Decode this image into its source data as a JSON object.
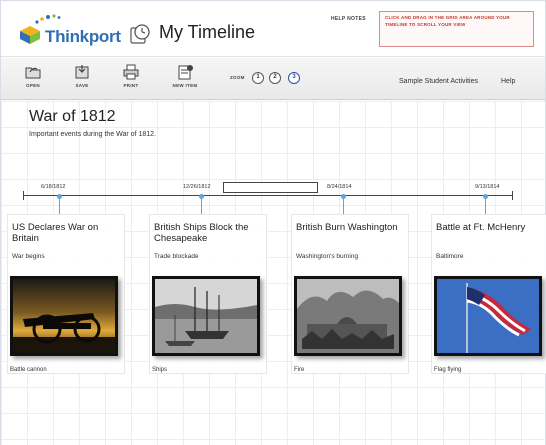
{
  "header": {
    "brand": "Thinkport",
    "app_title": "My Timeline",
    "help_notes_label": "HELP NOTES",
    "help_text": "CLICK AND DRAG IN THE GRID AREA AROUND YOUR TIMELINE TO SCROLL YOUR VIEW"
  },
  "toolbar": {
    "tools": [
      {
        "label": "OPEN",
        "icon": "open-folder-icon"
      },
      {
        "label": "SAVE",
        "icon": "save-icon"
      },
      {
        "label": "PRINT",
        "icon": "print-icon"
      },
      {
        "label": "NEW ITEM",
        "icon": "new-item-icon"
      }
    ],
    "zoom_label": "ZOOM",
    "zoom_levels": [
      "1",
      "2",
      "3"
    ],
    "active_zoom": "3",
    "links": [
      "Sample Student Activities",
      "Help"
    ]
  },
  "timeline": {
    "title": "War of 1812",
    "subtitle": "Important events during the War of 1812.",
    "dates": [
      "6/18/1812",
      "12/26/1812",
      "8/24/1814",
      "9/13/1814"
    ],
    "events": [
      {
        "title": "US Declares War on Britain",
        "description": "War begins",
        "caption": "Battle cannon",
        "image": "cannon-sunset-photo"
      },
      {
        "title": "British Ships Block the Chesapeake",
        "description": "Trade blockade",
        "caption": "Ships",
        "image": "harbor-ships-photo"
      },
      {
        "title": "British Burn Washington",
        "description": "Washington's burning",
        "caption": "Fire",
        "image": "burning-capitol-engraving"
      },
      {
        "title": "Battle at Ft. McHenry",
        "description": "Baltimore",
        "caption": "Flag flying",
        "image": "flag-flying-photo"
      }
    ]
  },
  "colors": {
    "brand_blue": "#2f6fb3",
    "help_red": "#c0392b",
    "pin_blue": "#5aa8d8",
    "grid": "#eceef3"
  }
}
